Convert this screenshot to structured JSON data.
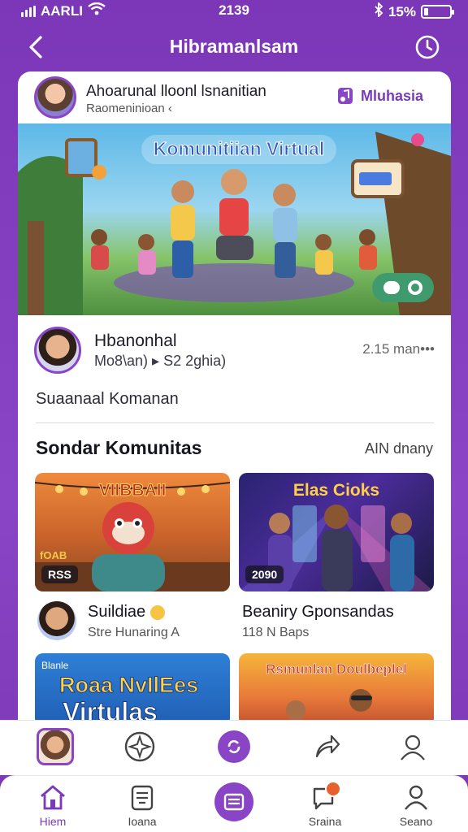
{
  "status_bar": {
    "carrier": "AARLI",
    "time": "2139",
    "battery": "15%",
    "battery_level": 0.15
  },
  "header": {
    "title": "Hibramanlsam",
    "back_icon": "chevron-left-icon",
    "history_icon": "clock-icon"
  },
  "card_header": {
    "title": "Ahoarunal lloonl lsnanitian",
    "subtitle": "Raomeninioan ‹",
    "action_label": "Mluhasia",
    "action_icon": "music-note-icon"
  },
  "banner": {
    "title": "Komunitiian Virtual"
  },
  "post": {
    "author_name": "Hbanonhal",
    "author_meta": "Mo8\\an) ▸ S2 2ghia)",
    "time": "2.15 man•••",
    "text": "Suaanaal Komanan"
  },
  "section": {
    "title": "Sondar Komunitas",
    "link": "AIN dnany"
  },
  "tiles": [
    {
      "label": "VIIBBAII",
      "badge": "RSS",
      "sticker": "fOAB"
    },
    {
      "label": "Elas Cioks",
      "badge": "2090"
    }
  ],
  "communities": [
    {
      "title": "Suildiae",
      "sub": "Stre Hunaring A"
    },
    {
      "title": "Beaniry Gponsandas",
      "sub": "118 N Baps"
    }
  ],
  "tiles_row2": [
    {
      "label": "Roaa NvIlEes",
      "label2": "Virtulas",
      "corner": "Blanle"
    },
    {
      "label": "Rsmunlan Doulbeplel"
    }
  ],
  "inner_nav": [
    {
      "icon": "profile-avatar-icon"
    },
    {
      "icon": "star-burst-icon"
    },
    {
      "icon": "refresh-icon"
    },
    {
      "icon": "share-arrow-icon"
    },
    {
      "icon": "user-icon"
    }
  ],
  "tabs": [
    {
      "label": "Hiem",
      "icon": "home-icon"
    },
    {
      "label": "Ioana",
      "icon": "id-card-icon"
    },
    {
      "label": "",
      "icon": "news-icon"
    },
    {
      "label": "Sraina",
      "icon": "chat-icon"
    },
    {
      "label": "Seano",
      "icon": "user-icon"
    }
  ],
  "colors": {
    "brand_purple": "#7a3bb8",
    "notification": "#e8612c"
  }
}
